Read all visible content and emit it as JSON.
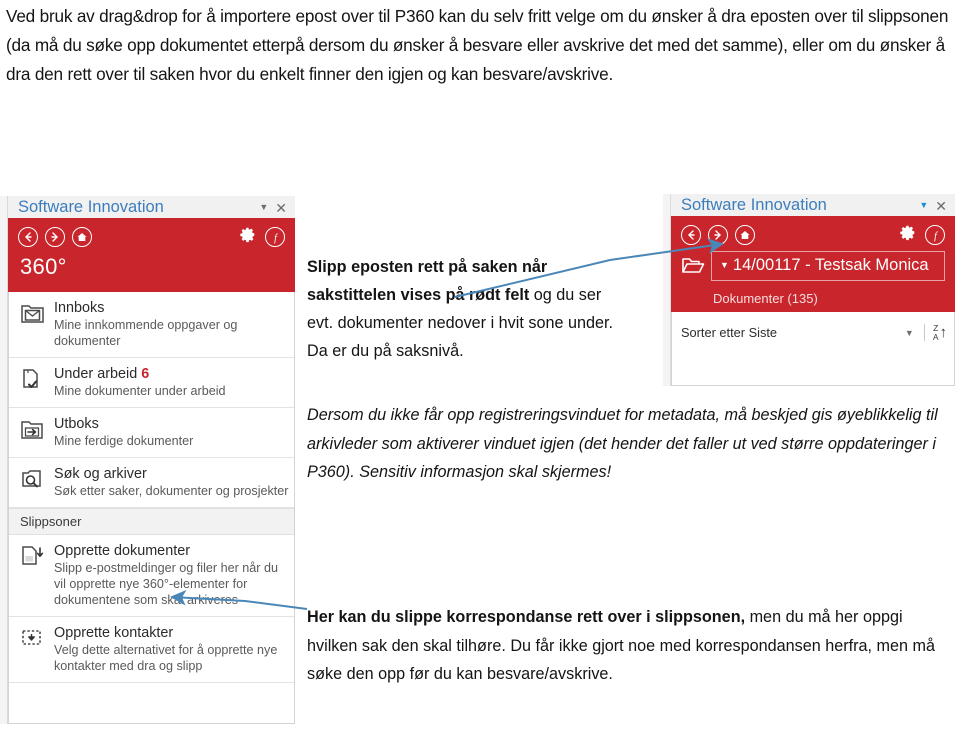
{
  "intro_paragraph": "Ved bruk av drag&drop for å importere epost over til P360 kan du selv fritt velge om du ønsker å dra eposten over til slippsonen (da må du søke opp dokumentet etterpå dersom du ønsker å besvare eller avskrive det med det samme), eller om du ønsker å dra den rett over til saken hvor du enkelt finner den igjen og kan besvare/avskrive.",
  "colors": {
    "brand_red": "#c8262c",
    "title_blue": "#3c7ebd",
    "arrow_blue": "#4a87b8",
    "count_red": "#c8262c"
  },
  "left_panel": {
    "title": "Software Innovation",
    "window_controls": {
      "dropdown": "chevron-down-icon",
      "close": "close-icon"
    },
    "toolbar": {
      "back": "back-arrow-icon",
      "forward": "forward-arrow-icon",
      "home": "home-icon",
      "settings": "gear-icon",
      "function": "f-circle-icon"
    },
    "brand": "360°",
    "items": [
      {
        "title": "Innboks",
        "count": "",
        "subtitle": "Mine innkommende oppgaver og dokumenter",
        "icon": "inbox-envelope-icon"
      },
      {
        "title": "Under arbeid",
        "count": "6",
        "subtitle": "Mine dokumenter under arbeid",
        "icon": "document-check-icon"
      },
      {
        "title": "Utboks",
        "count": "",
        "subtitle": "Mine ferdige dokumenter",
        "icon": "outbox-arrow-icon"
      },
      {
        "title": "Søk og arkiver",
        "count": "",
        "subtitle": "Søk etter saker, dokumenter og prosjekter",
        "icon": "search-archive-icon"
      }
    ],
    "section_header": "Slippsoner",
    "dropzones": [
      {
        "title": "Opprette dokumenter",
        "subtitle": "Slipp e-postmeldinger og filer her når du vil opprette nye 360°-elementer for dokumentene som skal arkiveres",
        "icon": "document-download-icon"
      },
      {
        "title": "Opprette kontakter",
        "subtitle": "Velg dette alternativet for å opprette nye kontakter med dra og slipp",
        "icon": "contact-dropzone-icon"
      }
    ]
  },
  "right_panel": {
    "title": "Software Innovation",
    "window_controls": {
      "dropdown": "chevron-down-icon",
      "close": "close-icon"
    },
    "toolbar": {
      "back": "back-arrow-icon",
      "forward": "forward-arrow-icon",
      "home": "home-icon",
      "settings": "gear-icon",
      "function": "f-circle-icon"
    },
    "case": {
      "folder_icon": "open-folder-icon",
      "case_title": "14/00117 - Testsak Monica",
      "documents_label": "Dokumenter (135)"
    },
    "sort_bar": {
      "label": "Sorter etter Siste",
      "dropdown": "chevron-down-icon",
      "sort_direction": "sort-za-ascending-icon",
      "za_top": "Z",
      "za_bottom": "A"
    }
  },
  "annotations": {
    "case_note_bold": "Slipp eposten rett på saken når sakstittelen vises på rødt felt",
    "case_note_rest": " og du ser evt. dokumenter nedover i hvit sone under. Da er du på saksnivå.",
    "italic_note": "Dersom du ikke får opp registreringsvinduet for metadata, må beskjed gis øyeblikkelig til arkivleder som aktiverer vinduet igjen (det hender det faller ut ved større oppdateringer i P360). Sensitiv informasjon skal skjermes!",
    "dropzone_note_bold": "Her kan du slippe korrespondanse rett over i slippsonen,",
    "dropzone_note_rest": " men du må her oppgi hvilken sak den skal tilhøre. Du får ikke gjort noe med korrespondansen herfra, men må søke den opp før du kan besvare/avskrive."
  }
}
